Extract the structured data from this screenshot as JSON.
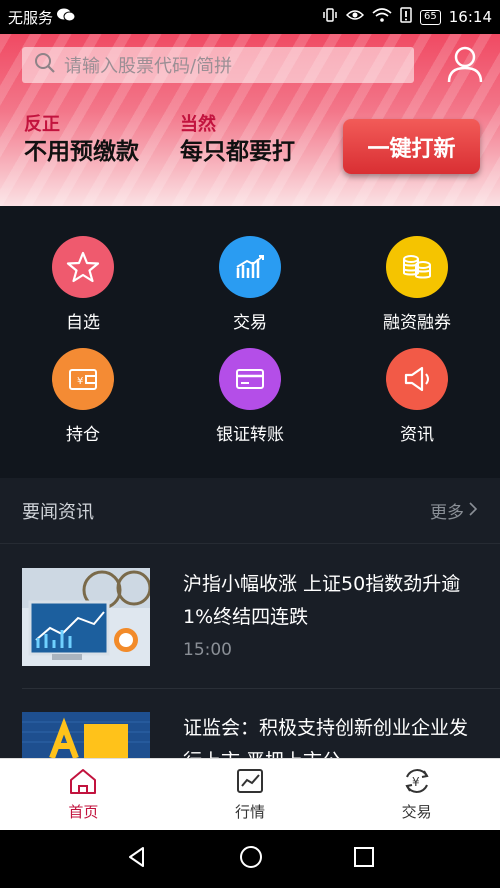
{
  "status_bar": {
    "carrier": "无服务",
    "battery": "65",
    "time": "16:14"
  },
  "search": {
    "placeholder": "请输入股票代码/简拼"
  },
  "promo": {
    "left_small": "反正",
    "left_big": "不用预缴款",
    "right_small": "当然",
    "right_big": "每只都要打",
    "cta_label": "一键打新"
  },
  "grid": [
    {
      "label": "自选",
      "icon": "star-icon",
      "color": "#ef5a6e"
    },
    {
      "label": "交易",
      "icon": "chart-bars-icon",
      "color": "#2a9cf2"
    },
    {
      "label": "融资融券",
      "icon": "coins-icon",
      "color": "#f5c400"
    },
    {
      "label": "持仓",
      "icon": "wallet-icon",
      "color": "#f48b34"
    },
    {
      "label": "银证转账",
      "icon": "card-icon",
      "color": "#b44ee8"
    },
    {
      "label": "资讯",
      "icon": "speaker-icon",
      "color": "#f25a47"
    }
  ],
  "news": {
    "title": "要闻资讯",
    "more": "更多",
    "items": [
      {
        "headline": "沪指小幅收涨 上证50指数劲升逾1%终结四连跌",
        "time": "15:00"
      },
      {
        "headline": "证监会：积极支持创新创业企业发行上市 严把上市公",
        "time": ""
      }
    ]
  },
  "tabs": [
    {
      "label": "首页",
      "icon": "home-icon",
      "active": true
    },
    {
      "label": "行情",
      "icon": "market-chart-icon",
      "active": false
    },
    {
      "label": "交易",
      "icon": "trade-yen-icon",
      "active": false
    }
  ]
}
